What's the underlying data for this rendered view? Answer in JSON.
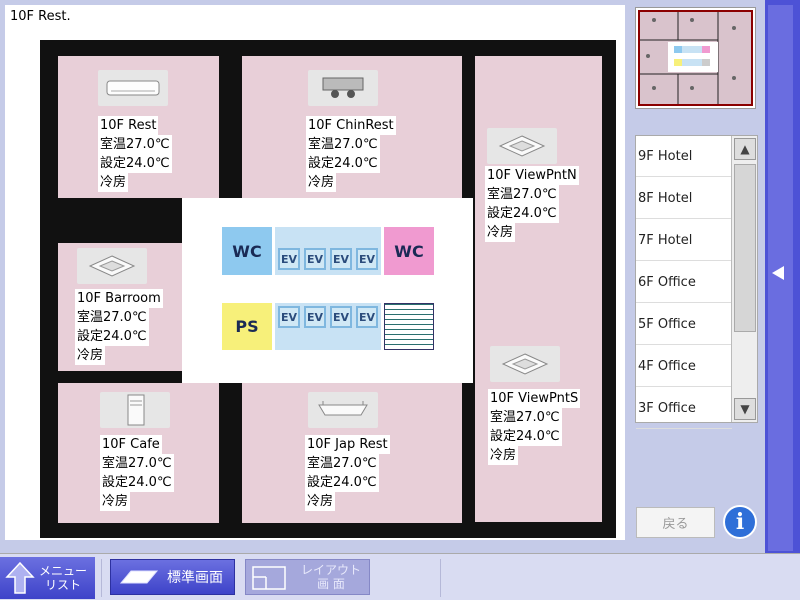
{
  "title": "10F Rest.",
  "rooms": [
    {
      "name": "10F Rest",
      "temp": "室温27.0℃",
      "setpoint": "設定24.0℃",
      "mode": "冷房",
      "icon": "wall-ac-icon"
    },
    {
      "name": "10F ChinRest",
      "temp": "室温27.0℃",
      "setpoint": "設定24.0℃",
      "mode": "冷房",
      "icon": "ducted-ac-icon"
    },
    {
      "name": "10F ViewPntN",
      "temp": "室温27.0℃",
      "setpoint": "設定24.0℃",
      "mode": "冷房",
      "icon": "cassette-ac-icon"
    },
    {
      "name": "10F Barroom",
      "temp": "室温27.0℃",
      "setpoint": "設定24.0℃",
      "mode": "冷房",
      "icon": "cassette-ac-icon"
    },
    {
      "name": "10F ViewPntS",
      "temp": "室温27.0℃",
      "setpoint": "設定24.0℃",
      "mode": "冷房",
      "icon": "cassette-ac-icon"
    },
    {
      "name": "10F Cafe",
      "temp": "室温27.0℃",
      "setpoint": "設定24.0℃",
      "mode": "冷房",
      "icon": "floor-ac-icon"
    },
    {
      "name": "10F Jap Rest",
      "temp": "室温27.0℃",
      "setpoint": "設定24.0℃",
      "mode": "冷房",
      "icon": "ceiling-ac-icon"
    }
  ],
  "core": {
    "wc_left": "WC",
    "wc_right": "WC",
    "ps": "PS",
    "ev": "EV"
  },
  "floors": [
    "9F Hotel",
    "8F Hotel",
    "7F Hotel",
    "6F Office",
    "5F Office",
    "4F Office",
    "3F Office"
  ],
  "back_label": "戻る",
  "info_label": "i",
  "bottom": {
    "menu_line1": "メニュー",
    "menu_line2": "リスト",
    "standard_view": "標準画面",
    "layout_line1": "レイアウト",
    "layout_line2": "画 面"
  },
  "colors": {
    "room": "#e8cfd8",
    "wc_left": "#8ec9ef",
    "wc_right": "#f09ad0",
    "ps": "#f7f07a",
    "accent": "#4d52d6"
  }
}
